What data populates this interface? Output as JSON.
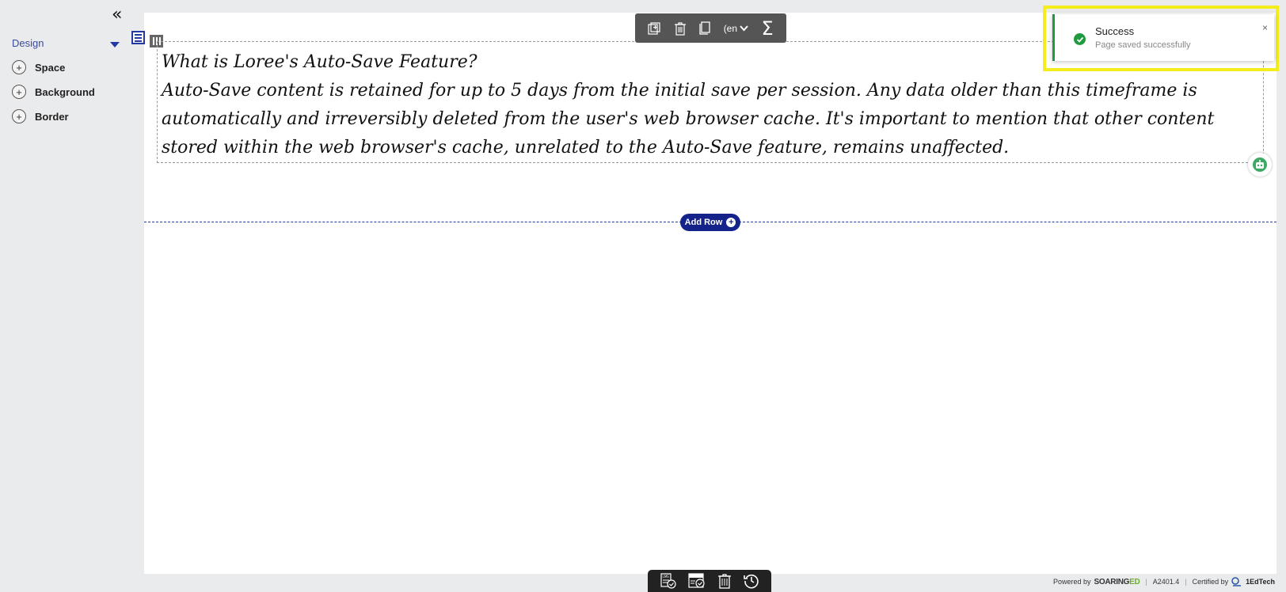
{
  "sidebar": {
    "collapse_glyph": "«",
    "section_label": "Design",
    "items": [
      {
        "label": "Space"
      },
      {
        "label": "Background"
      },
      {
        "label": "Border"
      }
    ]
  },
  "toolbar": {
    "lang_label": "(en"
  },
  "content": {
    "heading": "What is Loree's Auto-Save Feature?",
    "body": "Auto-Save content is retained for up to 5 days from the initial save per session. Any data older than this timeframe is automatically and irreversibly deleted from the user's web browser cache. It's important to mention that other content stored within the web browser's cache, unrelated to the Auto-Save feature, remains unaffected."
  },
  "add_row": {
    "label": "Add Row"
  },
  "toast": {
    "title": "Success",
    "message": "Page saved successfully",
    "close": "×"
  },
  "footer": {
    "powered_by": "Powered by",
    "brand_a": "SOARING",
    "brand_b": "ED",
    "version": "A2401.4",
    "certified_by": "Certified by",
    "certifier": "1EdTech"
  },
  "colors": {
    "accent": "#24399f",
    "success": "#1f9a3e",
    "highlight": "#f5ec1c"
  }
}
